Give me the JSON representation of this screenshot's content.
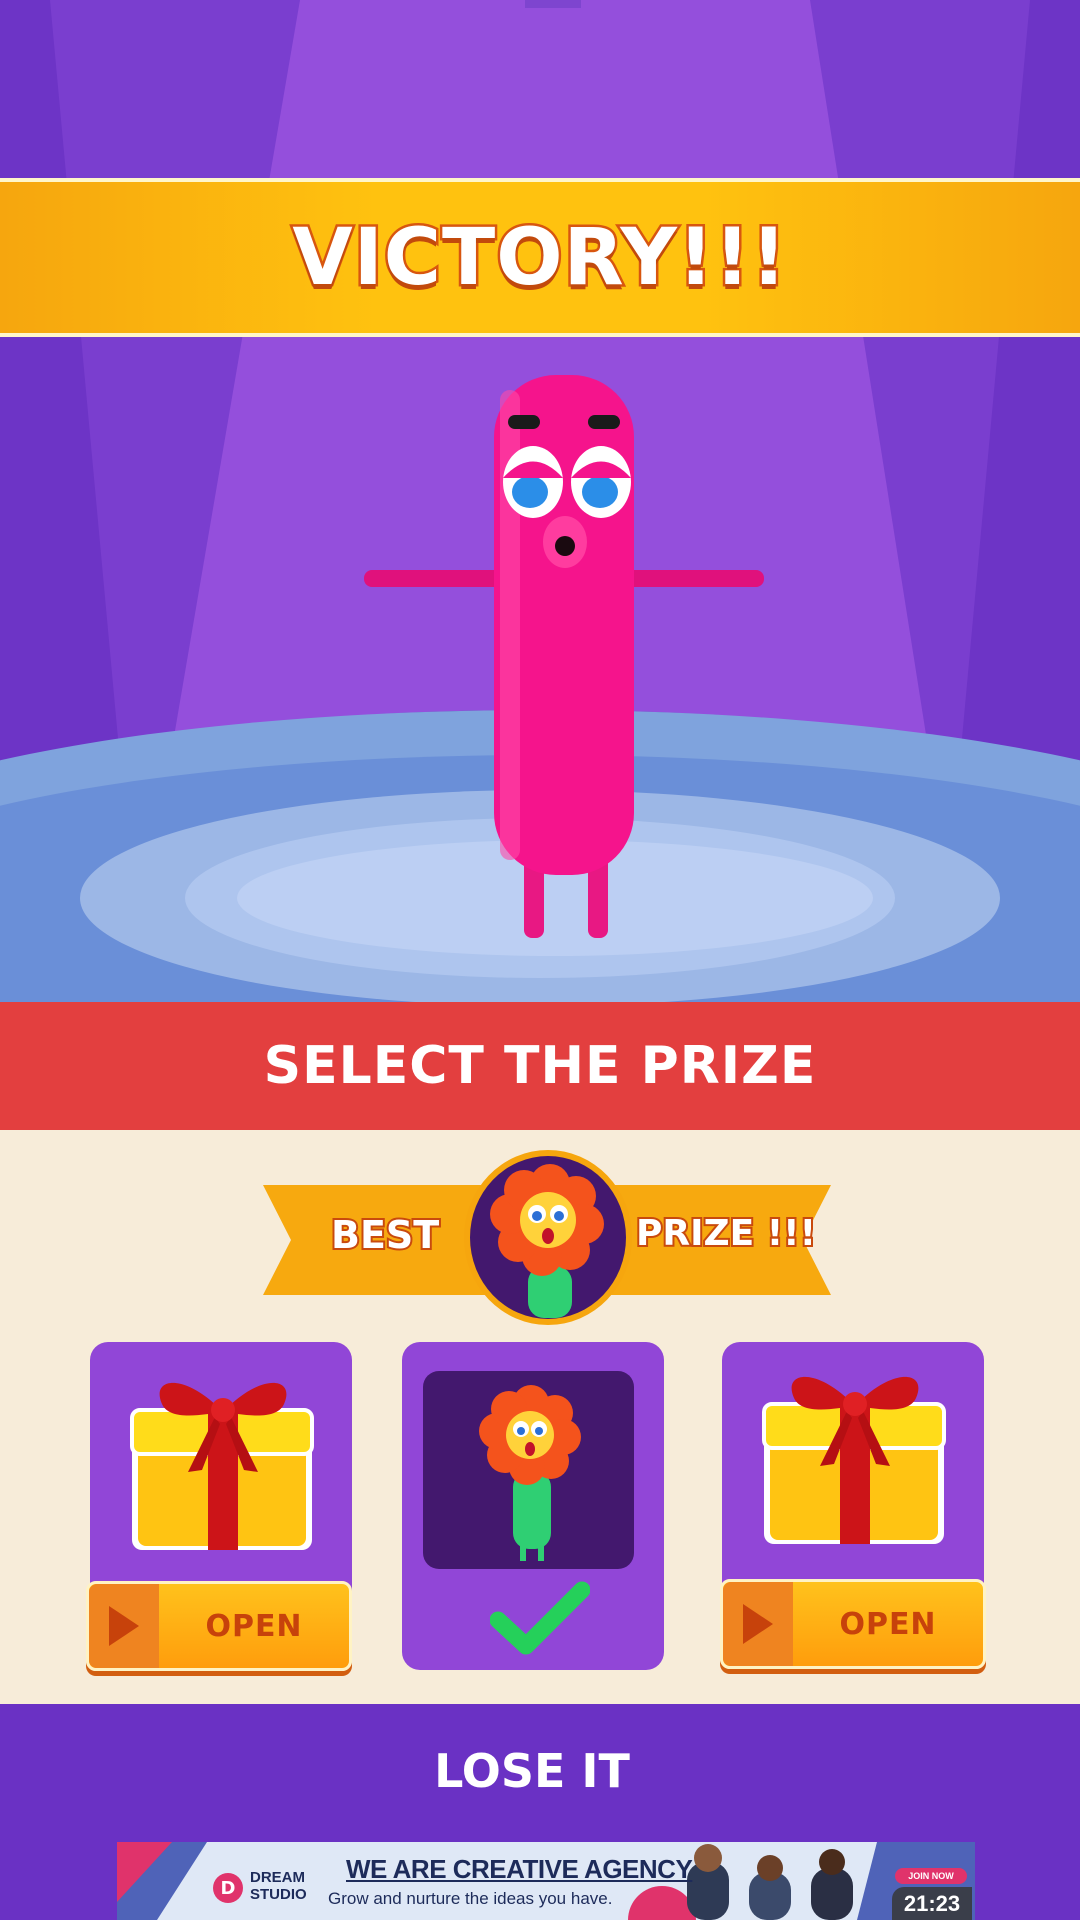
{
  "header": {
    "title": "VICTORY!!!"
  },
  "prize_section": {
    "title": "SELECT THE PRIZE",
    "best_prize_left": "BEST",
    "best_prize_right": "PRIZE !!!",
    "best_prize_character": "flower-character-icon"
  },
  "cards": [
    {
      "icon": "gift-box-icon",
      "button_label": "OPEN",
      "button_icon": "play-icon"
    },
    {
      "icon": "flower-character-icon",
      "status_icon": "checkmark-icon",
      "selected": true
    },
    {
      "icon": "gift-box-icon",
      "button_label": "OPEN",
      "button_icon": "play-icon"
    }
  ],
  "footer": {
    "lose_label": "LOSE IT"
  },
  "ad": {
    "logo_letter": "D",
    "brand_line1": "DREAM",
    "brand_line2": "STUDIO",
    "headline": "WE ARE CREATIVE AGENCY",
    "subline": "Grow and nurture the ideas you have.",
    "cta": "JOIN NOW",
    "timer": "21:23"
  },
  "colors": {
    "banner": "#ffc20f",
    "select_bar": "#e33f3f",
    "card": "#9146d7",
    "lose_bg": "#6a31c4",
    "character": "#f0158a"
  }
}
